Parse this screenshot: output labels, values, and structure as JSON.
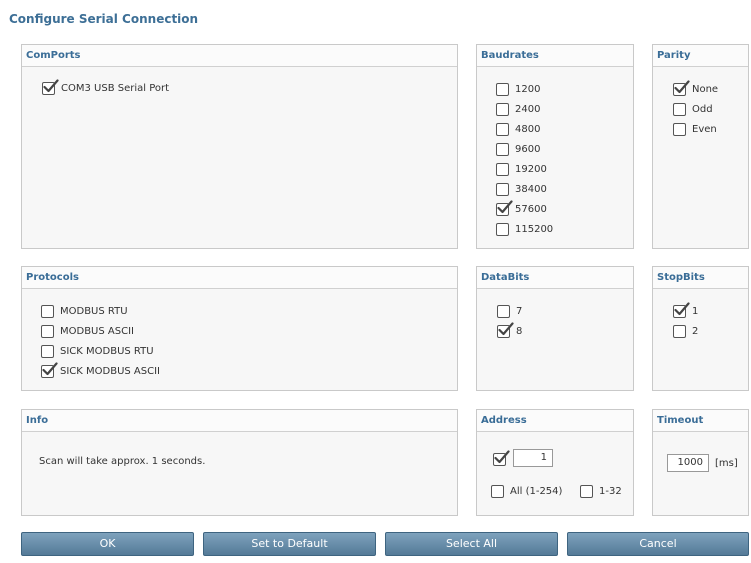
{
  "title": "Configure Serial Connection",
  "panels": {
    "comports": {
      "header": "ComPorts",
      "items": [
        {
          "label": "COM3 USB Serial Port",
          "checked": true
        }
      ]
    },
    "baudrates": {
      "header": "Baudrates",
      "items": [
        {
          "label": "1200",
          "checked": false
        },
        {
          "label": "2400",
          "checked": false
        },
        {
          "label": "4800",
          "checked": false
        },
        {
          "label": "9600",
          "checked": false
        },
        {
          "label": "19200",
          "checked": false
        },
        {
          "label": "38400",
          "checked": false
        },
        {
          "label": "57600",
          "checked": true
        },
        {
          "label": "115200",
          "checked": false
        }
      ]
    },
    "parity": {
      "header": "Parity",
      "items": [
        {
          "label": "None",
          "checked": true
        },
        {
          "label": "Odd",
          "checked": false
        },
        {
          "label": "Even",
          "checked": false
        }
      ]
    },
    "protocols": {
      "header": "Protocols",
      "items": [
        {
          "label": "MODBUS RTU",
          "checked": false
        },
        {
          "label": "MODBUS ASCII",
          "checked": false
        },
        {
          "label": "SICK MODBUS RTU",
          "checked": false
        },
        {
          "label": "SICK MODBUS ASCII",
          "checked": true
        }
      ]
    },
    "databits": {
      "header": "DataBits",
      "items": [
        {
          "label": "7",
          "checked": false
        },
        {
          "label": "8",
          "checked": true
        }
      ]
    },
    "stopbits": {
      "header": "StopBits",
      "items": [
        {
          "label": "1",
          "checked": true
        },
        {
          "label": "2",
          "checked": false
        }
      ]
    },
    "info": {
      "header": "Info",
      "text": "Scan will take approx.  1 seconds."
    },
    "address": {
      "header": "Address",
      "single_checked": true,
      "value": "1",
      "all_label": "All (1-254)",
      "all_checked": false,
      "range_label": "1-32",
      "range_checked": false
    },
    "timeout": {
      "header": "Timeout",
      "value": "1000",
      "unit": "[ms]"
    }
  },
  "buttons": {
    "ok": "OK",
    "default": "Set to Default",
    "select_all": "Select All",
    "cancel": "Cancel"
  },
  "colors": {
    "header_text": "#3a6d97",
    "button": "#6a90ad"
  },
  "icons": {
    "checkmark": "check-icon"
  }
}
